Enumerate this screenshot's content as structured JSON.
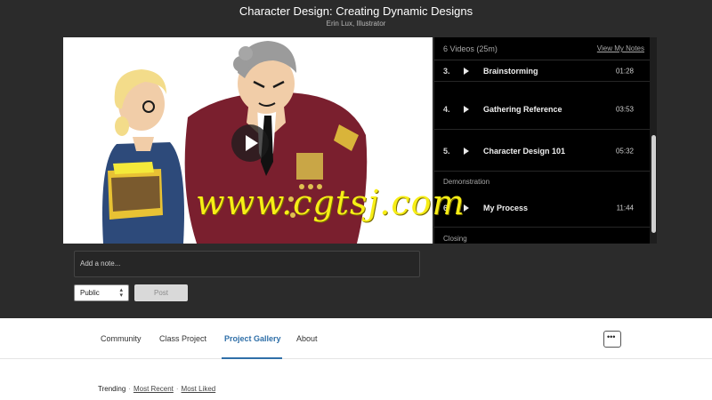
{
  "course": {
    "title": "Character Design: Creating Dynamic Designs",
    "author": "Erin Lux, Illustrator"
  },
  "player": {
    "play_icon": "play-icon"
  },
  "playlist": {
    "count": "6 Videos (25m)",
    "notes_link": "View My Notes",
    "items": [
      {
        "num": "3.",
        "title": "Brainstorming",
        "duration": "01:28"
      },
      {
        "num": "4.",
        "title": "Gathering Reference",
        "duration": "03:53"
      },
      {
        "num": "5.",
        "title": "Character Design 101",
        "duration": "05:32"
      },
      {
        "num": "6.",
        "title": "My Process",
        "duration": "11:44"
      }
    ],
    "sections": [
      "Demonstration",
      "Closing"
    ]
  },
  "note": {
    "placeholder": "Add a note...",
    "visibility": "Public",
    "post_label": "Post"
  },
  "tabs": [
    {
      "label": "Community"
    },
    {
      "label": "Class Project"
    },
    {
      "label": "Project Gallery",
      "active": true
    },
    {
      "label": "About"
    }
  ],
  "more_label": "•••",
  "filters": {
    "trending": "Trending",
    "separator": "·",
    "most_recent": "Most Recent",
    "most_liked": "Most Liked"
  },
  "watermark": "www.cgtsj.com",
  "colors": {
    "accent": "#2f6fa8",
    "dark_bg": "#2b2b2b",
    "playlist_bg": "#000000",
    "watermark": "#f7ee16"
  }
}
